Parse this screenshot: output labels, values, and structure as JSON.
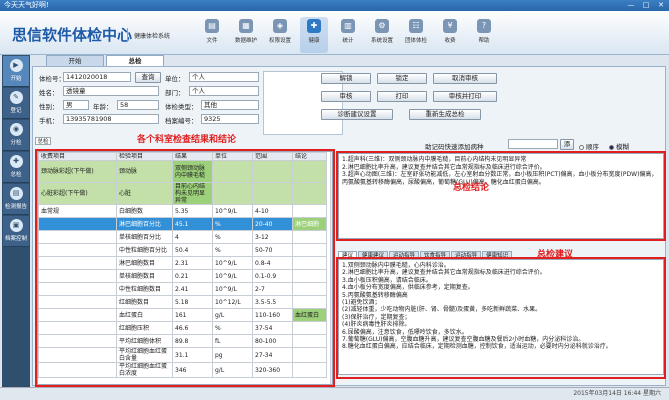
{
  "window": {
    "title": "今天天气好啊!",
    "min": "—",
    "max": "□",
    "close": "✕"
  },
  "brand": "思信软件体检中心",
  "subtitle": "健康体检系统",
  "toolbar": [
    {
      "label": "文件",
      "icon": "file-icon",
      "glyph": "▤"
    },
    {
      "label": "数据维护",
      "icon": "database-icon",
      "glyph": "▦"
    },
    {
      "label": "权限设置",
      "icon": "lock-icon",
      "glyph": "◈"
    },
    {
      "label": "健康",
      "icon": "health-icon",
      "glyph": "✚",
      "active": true
    },
    {
      "label": "统计",
      "icon": "statistics-icon",
      "glyph": "▥"
    },
    {
      "label": "系统设置",
      "icon": "settings-icon",
      "glyph": "⚙"
    },
    {
      "label": "团体体检",
      "icon": "group-icon",
      "glyph": "☷"
    },
    {
      "label": "收费",
      "icon": "payment-icon",
      "glyph": "¥"
    },
    {
      "label": "帮助",
      "icon": "help-icon",
      "glyph": "?"
    }
  ],
  "sidebar": [
    {
      "label": "开始",
      "icon": "start-icon",
      "glyph": "▶",
      "active": true
    },
    {
      "label": "登记",
      "icon": "register-icon",
      "glyph": "✎"
    },
    {
      "label": "分检",
      "icon": "sub-exam-icon",
      "glyph": "◉"
    },
    {
      "label": "总检",
      "icon": "general-exam-icon",
      "glyph": "✚"
    },
    {
      "label": "检测报告",
      "icon": "report-icon",
      "glyph": "▤"
    },
    {
      "label": "档案控制",
      "icon": "archive-icon",
      "glyph": "▣"
    }
  ],
  "tabs": [
    {
      "label": "开始"
    },
    {
      "label": "总检",
      "active": true
    }
  ],
  "patient": {
    "id_label": "体检号：",
    "id_value": "1412020018",
    "query_btn": "查询",
    "unit_label": "单位：",
    "unit_value": "个人",
    "name_label": "姓名：",
    "name_value": "透镜童",
    "dept_label": "部门：",
    "dept_value": "个人",
    "gender_label": "性别：",
    "gender_value": "男",
    "age_label": "年龄：",
    "age_value": "58",
    "type_label": "体检类型：",
    "type_value": "其他",
    "phone_label": "手机：",
    "phone_value": "13935781908",
    "file_label": "档案编号：",
    "file_value": "9325"
  },
  "actions": {
    "unlock": "解锁",
    "lock": "锁定",
    "cancel_review": "取消审核",
    "review": "审核",
    "print": "打印",
    "review_print": "审核并打印",
    "diag_setting": "诊断建议设置",
    "regenerate": "重新生成总检"
  },
  "section_tab": "总检",
  "table_label": "各个科室检查结果和结论",
  "table": {
    "headers": [
      "收费项目",
      "检验项目",
      "结果",
      "单位",
      "范围",
      "结论"
    ],
    "rows": [
      {
        "c": [
          "颈动脉彩超(下午做)",
          "颈动脉",
          "双侧颈动脉内中膜毛糙",
          "",
          "",
          ""
        ],
        "cls": "g"
      },
      {
        "c": [
          "心脏彩超(下午做)",
          "心脏",
          "目前心内结构未见明显异常",
          "",
          "",
          ""
        ],
        "cls": "g"
      },
      {
        "c": [
          "血常规",
          "白细胞数",
          "5.35",
          "10^9/L",
          "4-10",
          ""
        ],
        "cls": ""
      },
      {
        "c": [
          "",
          "淋巴细胞百分比",
          "45.1",
          "%",
          "20-40",
          "淋巴细胞"
        ],
        "cls": "sel"
      },
      {
        "c": [
          "",
          "单核细胞百分比",
          "4",
          "%",
          "3-12",
          ""
        ],
        "cls": ""
      },
      {
        "c": [
          "",
          "中性粒细胞百分比",
          "50.4",
          "%",
          "50-70",
          ""
        ],
        "cls": ""
      },
      {
        "c": [
          "",
          "淋巴细胞数目",
          "2.31",
          "10^9/L",
          "0.8-4",
          ""
        ],
        "cls": ""
      },
      {
        "c": [
          "",
          "单核细胞数目",
          "0.21",
          "10^9/L",
          "0.1-0.9",
          ""
        ],
        "cls": ""
      },
      {
        "c": [
          "",
          "中性粒细胞数目",
          "2.41",
          "10^9/L",
          "2-7",
          ""
        ],
        "cls": ""
      },
      {
        "c": [
          "",
          "红细胞数目",
          "5.18",
          "10^12/L",
          "3.5-5.5",
          ""
        ],
        "cls": ""
      },
      {
        "c": [
          "",
          "血红蛋白",
          "161",
          "g/L",
          "110-160",
          "血红蛋白"
        ],
        "cls": "hb"
      },
      {
        "c": [
          "",
          "红细胞压积",
          "46.6",
          "%",
          "37-54",
          ""
        ],
        "cls": ""
      },
      {
        "c": [
          "",
          "平均红细胞体积",
          "89.8",
          "fL",
          "80-100",
          ""
        ],
        "cls": ""
      },
      {
        "c": [
          "",
          "平均红细胞血红蛋白含量",
          "31.1",
          "pg",
          "27-34",
          ""
        ],
        "cls": ""
      },
      {
        "c": [
          "",
          "平均红细胞血红蛋白浓度",
          "346",
          "g/L",
          "320-360",
          ""
        ],
        "cls": ""
      }
    ]
  },
  "assist": {
    "label": "助记码快速添加病种",
    "btn": "添",
    "opt1": "顺序",
    "opt2": "模糊"
  },
  "conclusion_label": "总检结论",
  "conclusion": [
    "1.超声科(三维)：双侧颈动脉内中膜毛糙，目前心内结构未见明显异常",
    "2.淋巴细胞比率升高，建议复查并结合其它血常规指标及临床进行综合评价。",
    "3.超声心动图(三维)：左室舒张功能减低，左心室射血分数正常，血小板压积(PCT)偏高，血小板分布宽度(PDW)偏高，丙氨酸氨基转移酶偏高，尿酸偏高，葡萄糖(GLU)偏高，糖化血红蛋白偏高。"
  ],
  "subtabs": [
    "建议",
    "健康建议",
    "运动指导",
    "饮食指导",
    "运动指导",
    "健康知识"
  ],
  "advice_label": "总检建议",
  "advice": [
    "1.双侧颈动脉内中膜毛糙，心内科诊治。",
    "2.淋巴细胞比率升高，建议复查并结合其它血常规指标及临床进行综合评价。",
    "3.血小板压积偏高，请结合临床。",
    "4.血小板分布宽度偏高，供临床参考，定期复查。",
    "5.丙氨酸氨基转移酶偏高",
    "(1)避免饮酒；",
    "(2)减轻体重，少吃动物内脏(肝、肾、骨髓)及蛋黄，多吃新鲜蔬菜、水果。",
    "(3)保肝治疗，定期复查；",
    "(4)肝炎病毒性肝炎排除。",
    "6.尿酸偏高，注意饮食，低嘌呤饮食，多饮水。",
    "7.葡萄糖(GLU)偏高，空腹血糖升高，建议复查空腹血糖及餐后2小时血糖，内分泌科诊治。",
    "8.糖化血红蛋白偏高，应结合临床，定期检测血糖，控制饮食，适当运动，必要时内分泌科就诊治疗。"
  ],
  "status": "2015年03月14日 16:44 星期六",
  "colors": {
    "accent": "#2e79c5",
    "highlight": "#e02020",
    "row_green": "#c2e0a8",
    "selected": "#3290d8"
  }
}
